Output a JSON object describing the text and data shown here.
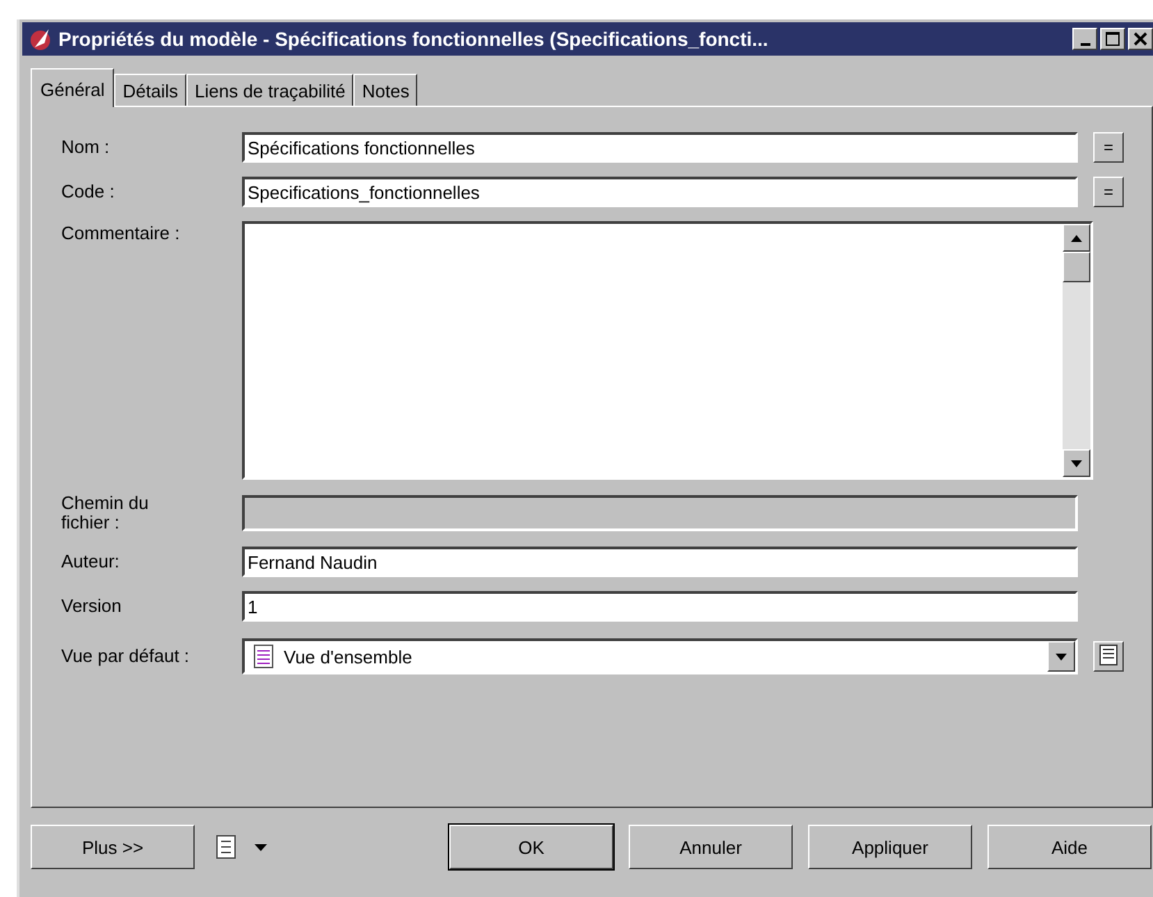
{
  "window": {
    "title": "Propriétés du modèle - Spécifications fonctionnelles (Specifications_foncti..."
  },
  "tabs": [
    {
      "label": "Général",
      "selected": true
    },
    {
      "label": "Détails",
      "selected": false
    },
    {
      "label": "Liens de traçabilité",
      "selected": false
    },
    {
      "label": "Notes",
      "selected": false
    }
  ],
  "fields": [
    {
      "kind": "text",
      "label": "Nom :",
      "value": "Spécifications fonctionnelles",
      "button": "="
    },
    {
      "kind": "text",
      "label": "Code :",
      "value": "Specifications_fonctionnelles",
      "button": "="
    },
    {
      "kind": "memo",
      "label": "Commentaire :"
    },
    {
      "kind": "text",
      "label": "Chemin du fichier :",
      "disabled": true
    },
    {
      "kind": "text",
      "label": "Auteur:",
      "value": "Fernand Naudin"
    },
    {
      "kind": "text",
      "label": "Version",
      "value": "1"
    },
    {
      "kind": "combo",
      "label": "Vue par défaut :",
      "value": "Vue d'ensemble"
    }
  ],
  "buttons": [
    {
      "label": "Plus >>",
      "kind": "button"
    },
    {
      "kind": "menu"
    },
    {
      "label": "OK",
      "kind": "default"
    },
    {
      "label": "Annuler",
      "kind": "button"
    },
    {
      "label": "Appliquer",
      "kind": "button"
    },
    {
      "label": "Aide",
      "kind": "button"
    }
  ]
}
